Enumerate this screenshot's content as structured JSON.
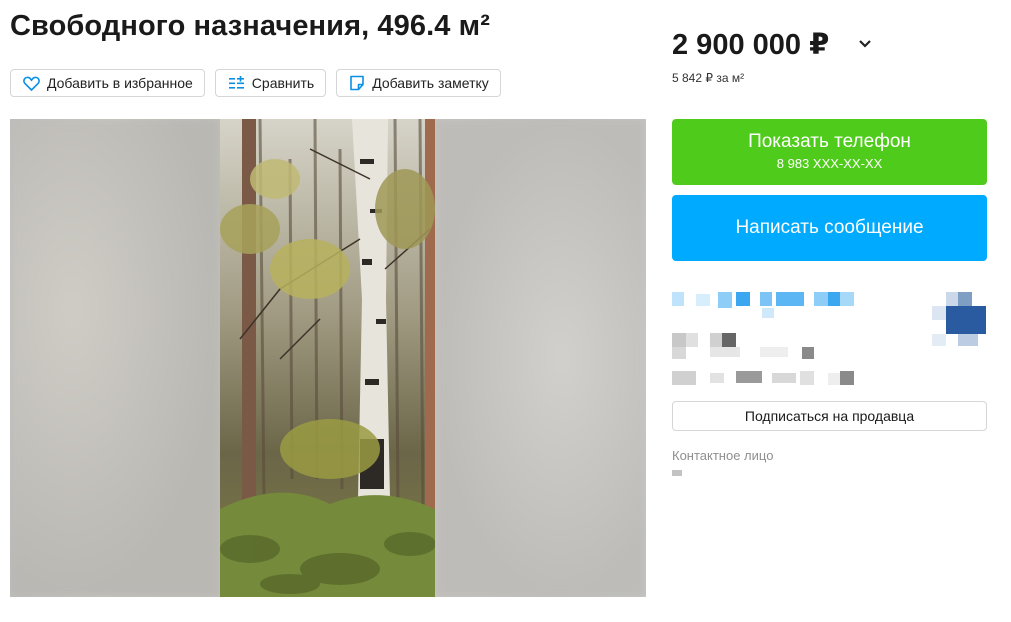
{
  "listing": {
    "title": "Свободного назначения, 496.4 м²",
    "price": "2 900 000 ₽",
    "price_per_m2": "5 842 ₽ за м²"
  },
  "actions": {
    "favorite_label": "Добавить в избранное",
    "compare_label": "Сравнить",
    "note_label": "Добавить заметку"
  },
  "contact": {
    "show_phone_label": "Показать телефон",
    "phone_masked": "8 983 XXX-XX-XX",
    "message_label": "Написать сообщение",
    "subscribe_label": "Подписаться на продавца",
    "contact_person_label": "Контактное лицо"
  },
  "icons": {
    "favorite": "heart-icon",
    "compare": "compare-icon",
    "note": "note-icon",
    "price_dropdown": "chevron-down-icon"
  },
  "colors": {
    "phone_button": "#4fcc1b",
    "message_button": "#00aaff"
  }
}
